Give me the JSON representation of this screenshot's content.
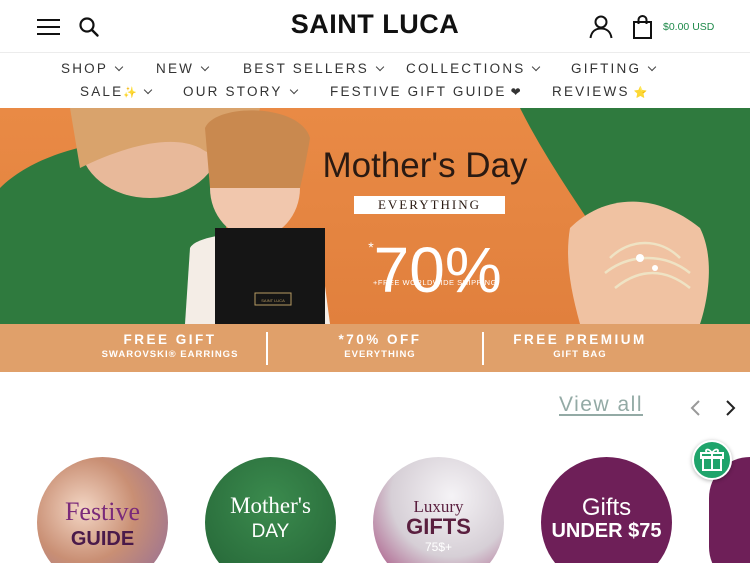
{
  "header": {
    "logo": "SAINT LUCA",
    "cart_total": "$0.00 USD"
  },
  "nav": {
    "row1": [
      "SHOP",
      "NEW",
      "BEST SELLERS",
      "COLLECTIONS",
      "GIFTING"
    ],
    "row2": {
      "sale": "SALE",
      "our_story": "OUR STORY",
      "festive": "FESTIVE GIFT GUIDE",
      "reviews": "REVIEWS"
    }
  },
  "hero": {
    "headline": "Mother's Day",
    "badge": "EVERYTHING",
    "percent": "70%",
    "percent_prefix": "*",
    "shipping": "+FREE WORLDWIDE SHIPPING",
    "box_label": "SAINT LUCA",
    "strip": [
      {
        "title": "FREE GIFT",
        "sub": "SWAROVSKI® EARRINGS"
      },
      {
        "title": "*70% OFF",
        "sub": "EVERYTHING"
      },
      {
        "title": "FREE PREMIUM",
        "sub": "GIFT BAG"
      }
    ]
  },
  "carousel": {
    "view_all": "View all",
    "items": [
      {
        "line1": "Festive",
        "line2": "GUIDE"
      },
      {
        "line1": "Mother's",
        "line2": "DAY"
      },
      {
        "line1": "Luxury",
        "line2": "GIFTS",
        "line3": "75$+"
      },
      {
        "line1": "Gifts",
        "line2": "UNDER $75"
      }
    ]
  },
  "colors": {
    "accent_green": "#1e8a4a",
    "view_all": "#93aaa5",
    "hero_orange": "#e1803d",
    "strip_orange": "#e0a06a",
    "plum": "#6e1f58"
  },
  "icons": [
    "menu-icon",
    "search-icon",
    "user-icon",
    "shopping-bag-icon",
    "chevron-left-icon",
    "chevron-right-icon",
    "gift-icon"
  ]
}
